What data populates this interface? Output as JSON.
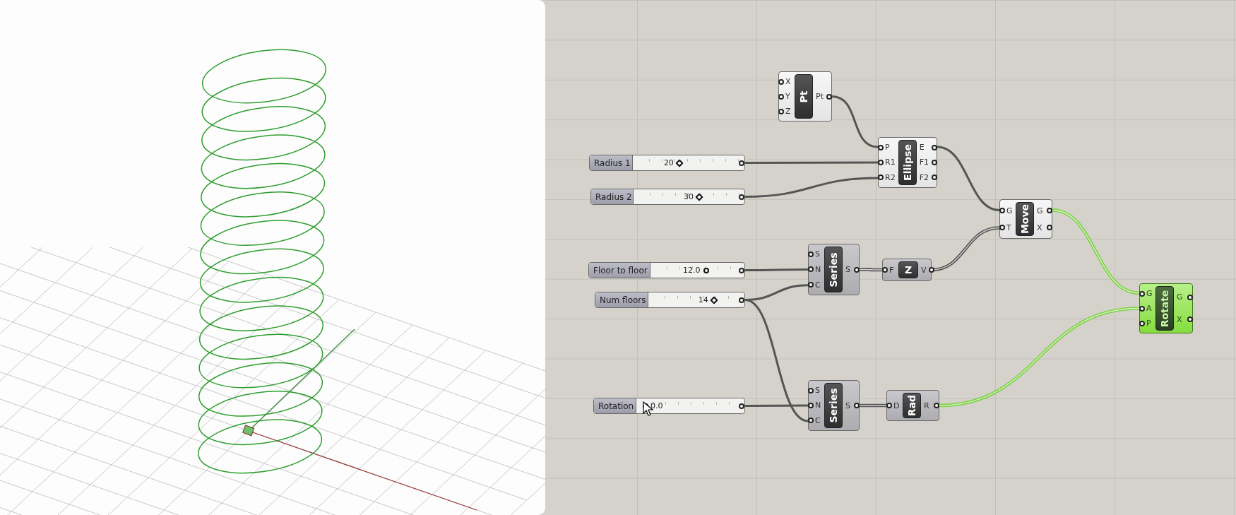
{
  "sliders": [
    {
      "label": "Radius 1",
      "value": "20",
      "kind": "integer",
      "level": 0.41
    },
    {
      "label": "Radius 2",
      "value": "30",
      "kind": "integer",
      "level": 0.6
    },
    {
      "label": "Floor to floor",
      "value": "12.0",
      "kind": "decimal",
      "level": 0.6
    },
    {
      "label": "Num floors",
      "value": "14",
      "kind": "integer",
      "level": 0.7
    },
    {
      "label": "Rotation",
      "value": "0.0",
      "kind": "decimal",
      "level": 0.05
    }
  ],
  "components": [
    {
      "name": "Pt",
      "inputs": [
        "X",
        "Y",
        "Z"
      ],
      "outputs": [
        "Pt"
      ],
      "preview": true,
      "selected": false
    },
    {
      "name": "Ellipse",
      "inputs": [
        "P",
        "R1",
        "R2"
      ],
      "outputs": [
        "E",
        "F1",
        "F2"
      ],
      "preview": true,
      "selected": false
    },
    {
      "name": "Move",
      "inputs": [
        "G",
        "T"
      ],
      "outputs": [
        "G",
        "X"
      ],
      "preview": true,
      "selected": false
    },
    {
      "name": "Series",
      "inputs": [
        "S",
        "N",
        "C"
      ],
      "outputs": [
        "S"
      ],
      "preview": false,
      "selected": false
    },
    {
      "name": "Z",
      "inputs": [
        "F"
      ],
      "outputs": [
        "V"
      ],
      "preview": false,
      "selected": false
    },
    {
      "name": "Rotate",
      "inputs": [
        "G",
        "A",
        "P"
      ],
      "outputs": [
        "G",
        "X"
      ],
      "selected": true
    },
    {
      "name": "Series",
      "inputs": [
        "S",
        "N",
        "C"
      ],
      "outputs": [
        "S"
      ],
      "preview": false,
      "selected": false
    },
    {
      "name": "Rad",
      "inputs": [
        "D"
      ],
      "outputs": [
        "R"
      ],
      "preview": false,
      "selected": false
    }
  ]
}
